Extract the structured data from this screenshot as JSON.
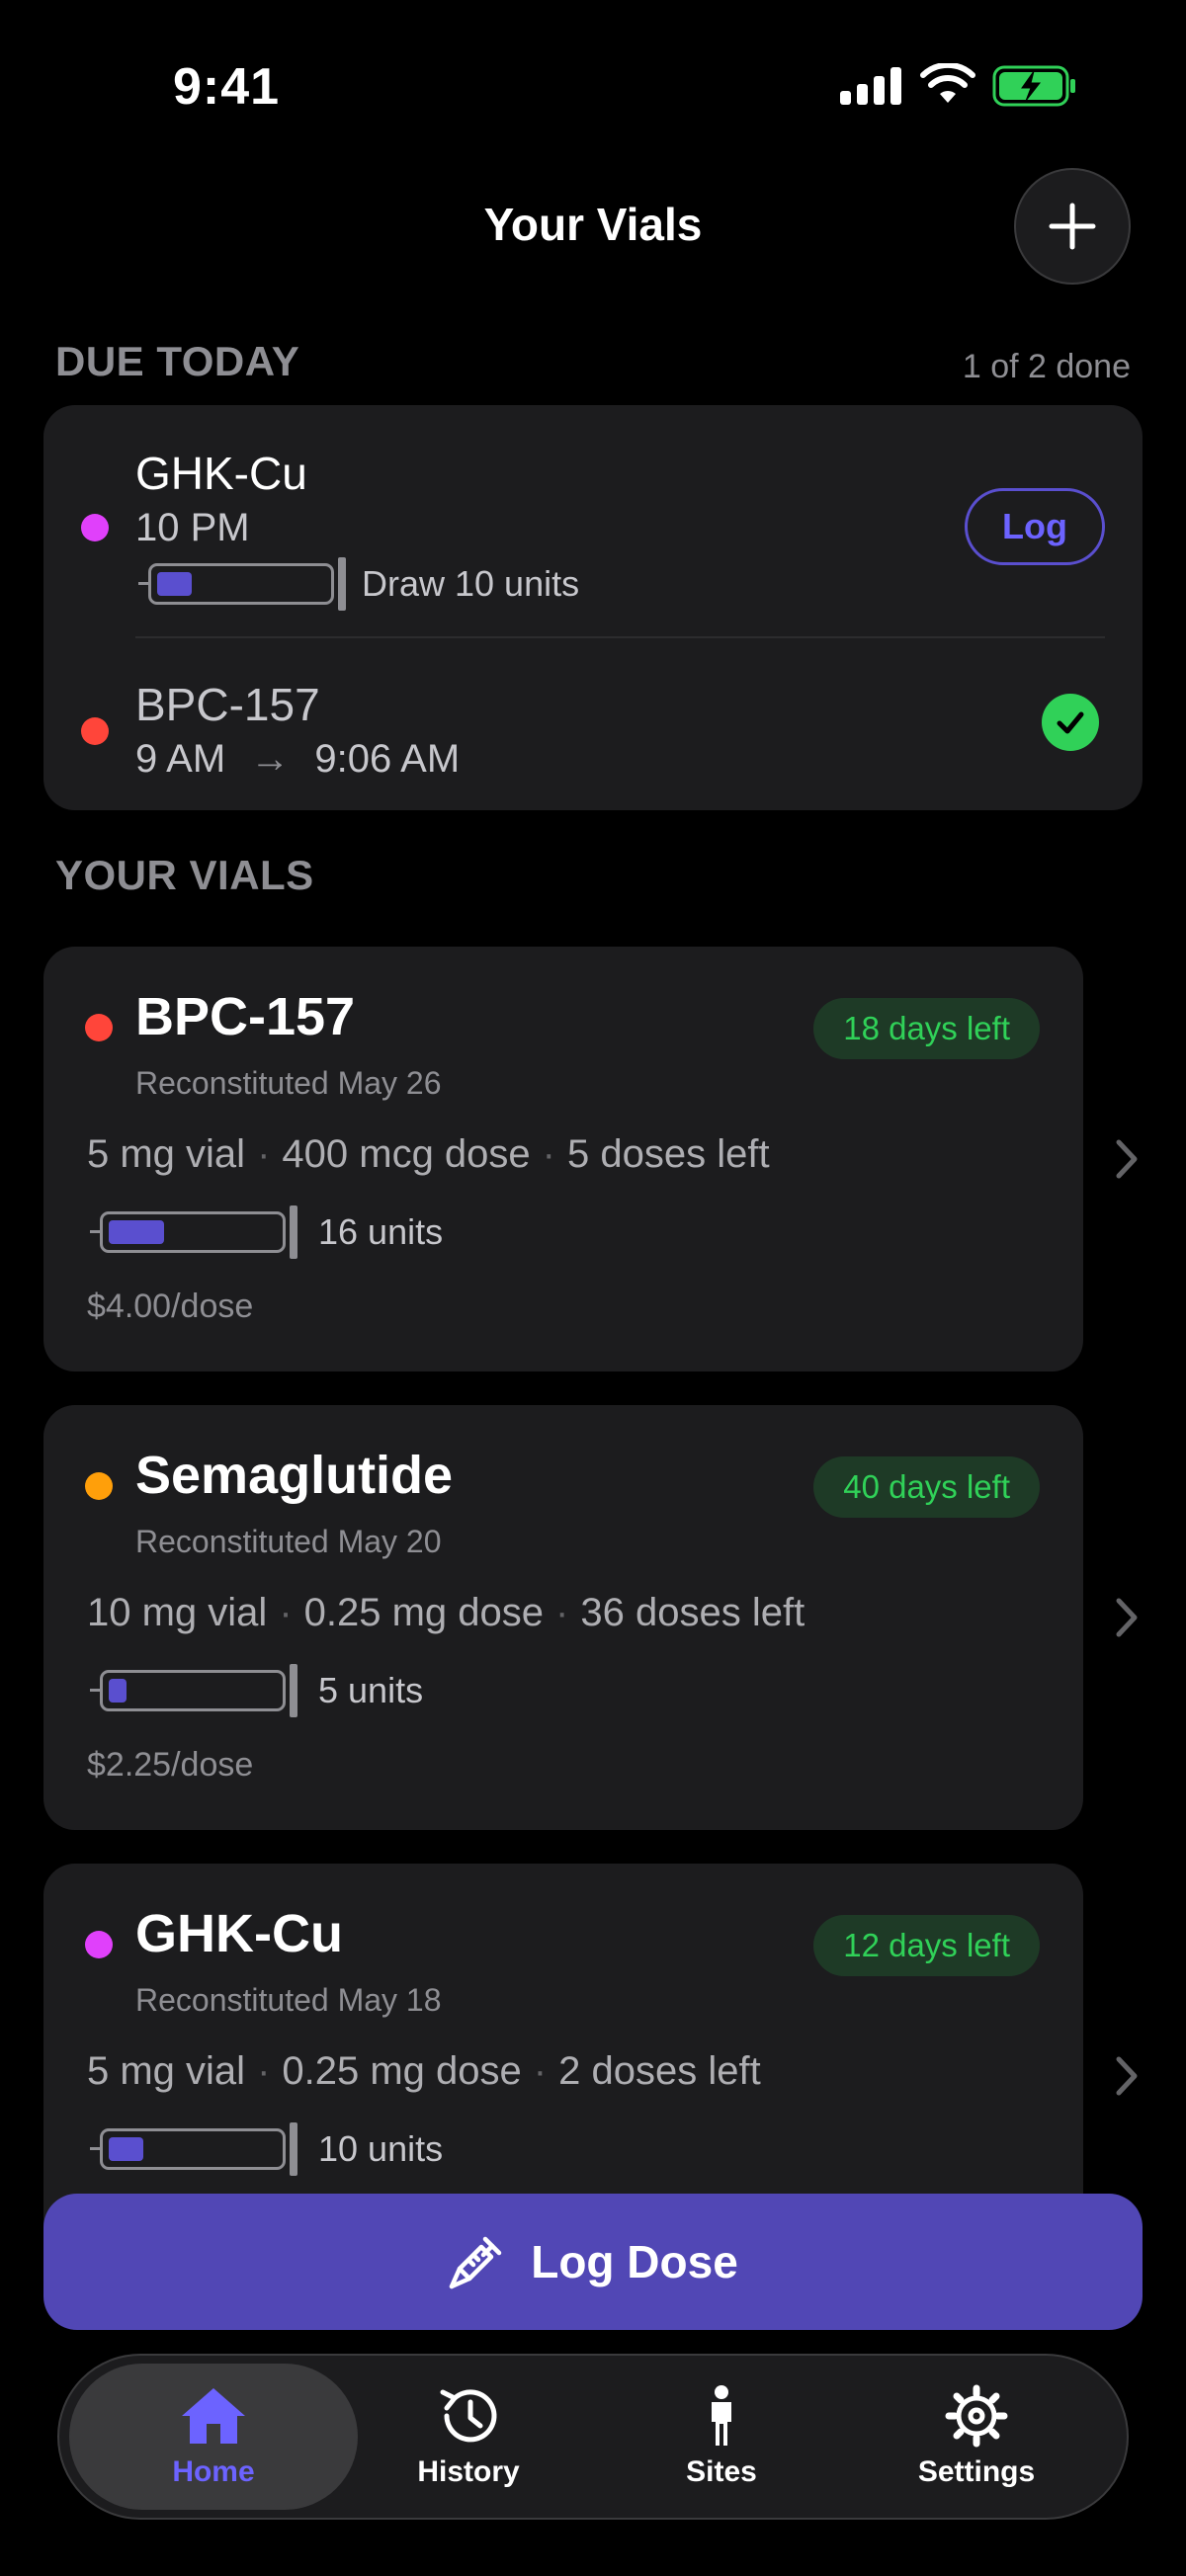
{
  "status_bar": {
    "time": "9:41"
  },
  "header": {
    "title": "Your Vials"
  },
  "due_today": {
    "label": "DUE TODAY",
    "progress": "1 of 2 done",
    "items": [
      {
        "name": "GHK-Cu",
        "time": "10 PM",
        "dot_color": "#e040fb",
        "syringe_label": "Draw 10 units",
        "fill_fraction": 0.2,
        "action": "Log"
      },
      {
        "name": "BPC-157",
        "time_scheduled": "9 AM",
        "arrow": "→",
        "time_taken": "9:06 AM",
        "dot_color": "#ff453a",
        "done": true
      }
    ]
  },
  "vials": {
    "label": "YOUR VIALS",
    "items": [
      {
        "name": "BPC-157",
        "dot_color": "#ff453a",
        "reconstituted": "Reconstituted May 26",
        "days_left": "18 days left",
        "vial_size": "5 mg vial",
        "dose": "400 mcg dose",
        "doses_left": "5 doses left",
        "units": "16 units",
        "fill_fraction": 0.32,
        "cost": "$4.00/dose"
      },
      {
        "name": "Semaglutide",
        "dot_color": "#ff9f0a",
        "reconstituted": "Reconstituted May 20",
        "days_left": "40 days left",
        "vial_size": "10 mg vial",
        "dose": "0.25 mg dose",
        "doses_left": "36 doses left",
        "units": "5 units",
        "fill_fraction": 0.1,
        "cost": "$2.25/dose"
      },
      {
        "name": "GHK-Cu",
        "dot_color": "#e040fb",
        "reconstituted": "Reconstituted May 18",
        "days_left": "12 days left",
        "vial_size": "5 mg vial",
        "dose": "0.25 mg dose",
        "doses_left": "2 doses left",
        "units": "10 units",
        "fill_fraction": 0.2,
        "cost": ""
      }
    ]
  },
  "log_dose": {
    "label": "Log Dose"
  },
  "tabs": [
    {
      "label": "Home",
      "icon": "home-icon",
      "active": true
    },
    {
      "label": "History",
      "icon": "history-icon",
      "active": false
    },
    {
      "label": "Sites",
      "icon": "person-icon",
      "active": false
    },
    {
      "label": "Settings",
      "icon": "gear-icon",
      "active": false
    }
  ],
  "colors": {
    "accent": "#5147b5",
    "success": "#30d158",
    "card": "#1c1c1e"
  }
}
